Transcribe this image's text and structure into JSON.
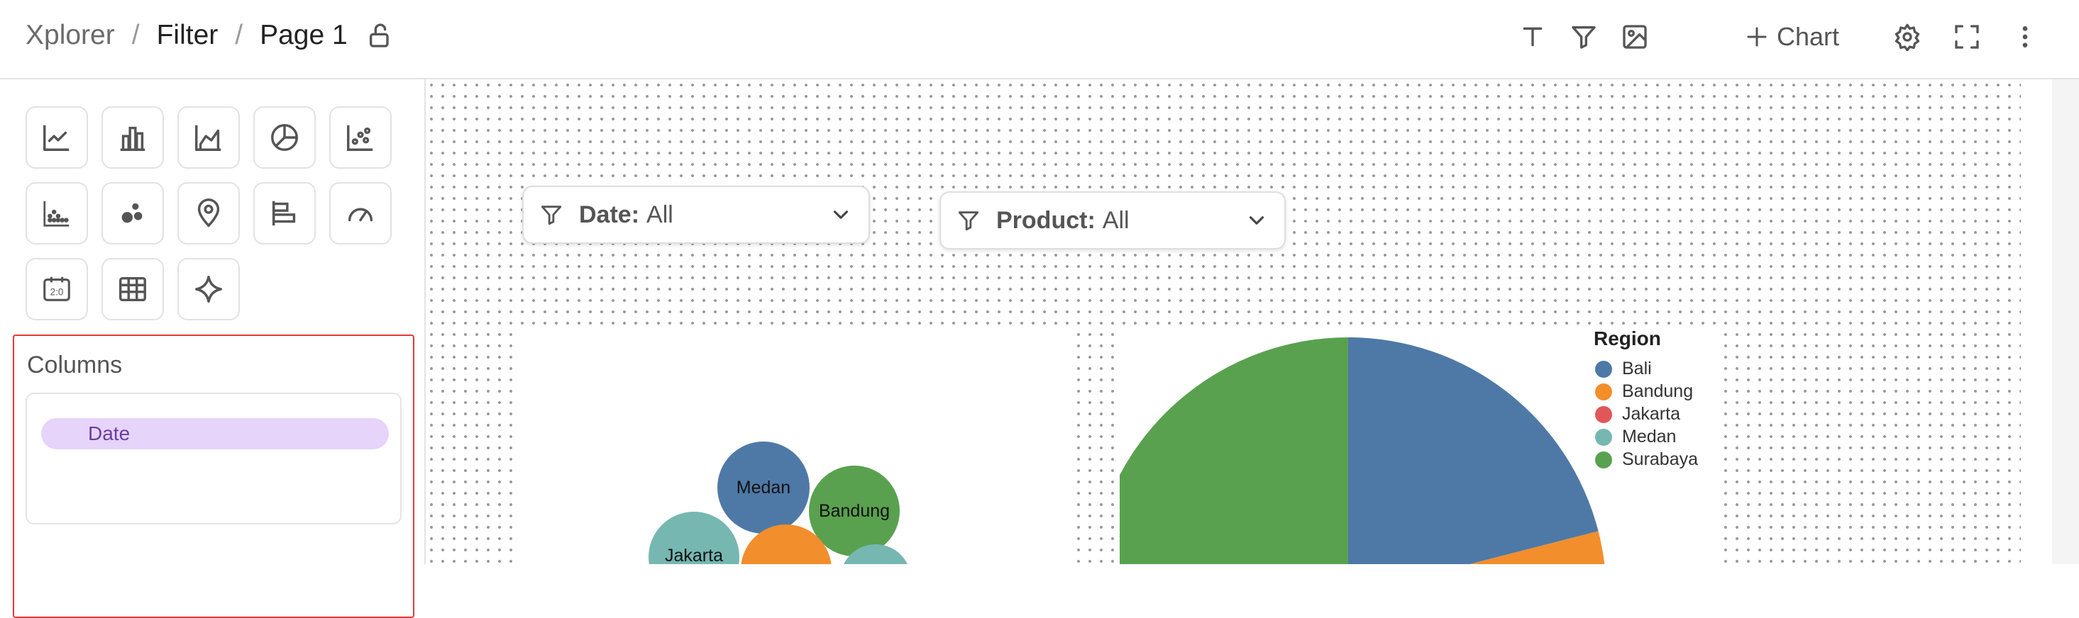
{
  "breadcrumb": {
    "root": "Xplorer",
    "filter": "Filter",
    "page": "Page 1",
    "separator": "/"
  },
  "toolbar": {
    "text_icon": "text-icon",
    "filter_icon": "filter-icon",
    "image_icon": "image-icon",
    "add_chart_label": "Chart",
    "settings_icon": "gear-icon",
    "fullscreen_icon": "fullscreen-icon",
    "more_icon": "more-vertical-icon"
  },
  "chart_types": [
    "line-chart-icon",
    "bar-chart-icon",
    "area-chart-icon",
    "pie-chart-icon",
    "scatter-chart-icon",
    "dot-plot-icon",
    "bubble-chart-icon",
    "map-pin-icon",
    "horizontal-bar-icon",
    "gauge-icon",
    "scoreboard-icon",
    "table-icon",
    "sparkle-icon"
  ],
  "columns": {
    "title": "Columns",
    "items": [
      "Date"
    ]
  },
  "filters": [
    {
      "label": "Date:",
      "value": "All"
    },
    {
      "label": "Product:",
      "value": "All"
    }
  ],
  "colors": {
    "Bali": "#4e79a7",
    "Bandung": "#f28e2b",
    "Jakarta": "#e15759",
    "Medan": "#76b7b2",
    "Surabaya": "#59a14f",
    "accent_border": "#e53935",
    "pill": "#e6d4fa"
  },
  "bubble_chart": {
    "labels": [
      "Medan",
      "Bandung",
      "Jakarta"
    ]
  },
  "legend": {
    "title": "Region",
    "items": [
      "Bali",
      "Bandung",
      "Jakarta",
      "Medan",
      "Surabaya"
    ]
  },
  "chart_data": {
    "type": "pie",
    "legend_title": "Region",
    "categories": [
      "Bali",
      "Bandung",
      "Jakarta",
      "Medan",
      "Surabaya"
    ],
    "visible_slices": [
      {
        "name": "Bali",
        "value": 0.21
      },
      {
        "name": "Bandung",
        "value": 0.04
      },
      {
        "name": "Medan",
        "value": 0.02
      },
      {
        "name": "Surabaya",
        "value": 0.23
      }
    ],
    "legend_placement": "top-right"
  }
}
